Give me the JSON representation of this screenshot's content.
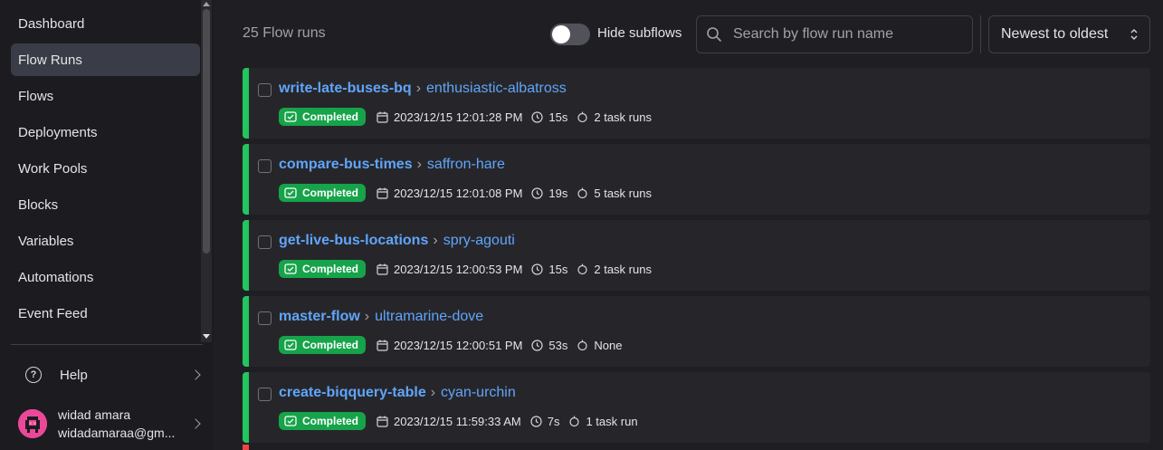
{
  "sidebar": {
    "items": [
      {
        "label": "Dashboard"
      },
      {
        "label": "Flow Runs",
        "active": true
      },
      {
        "label": "Flows"
      },
      {
        "label": "Deployments"
      },
      {
        "label": "Work Pools"
      },
      {
        "label": "Blocks"
      },
      {
        "label": "Variables"
      },
      {
        "label": "Automations"
      },
      {
        "label": "Event Feed"
      }
    ],
    "help_label": "Help",
    "user": {
      "name": "widad amara",
      "email": "widadamaraa@gm..."
    }
  },
  "header": {
    "count_label": "25 Flow runs",
    "hide_subflows_label": "Hide subflows",
    "hide_subflows_on": false,
    "search_placeholder": "Search by flow run name",
    "sort_value": "Newest to oldest"
  },
  "runs": [
    {
      "flow": "write-late-buses-bq",
      "name": "enthusiastic-albatross",
      "status": "Completed",
      "timestamp": "2023/12/15 12:01:28 PM",
      "duration": "15s",
      "tasks": "2 task runs"
    },
    {
      "flow": "compare-bus-times",
      "name": "saffron-hare",
      "status": "Completed",
      "timestamp": "2023/12/15 12:01:08 PM",
      "duration": "19s",
      "tasks": "5 task runs"
    },
    {
      "flow": "get-live-bus-locations",
      "name": "spry-agouti",
      "status": "Completed",
      "timestamp": "2023/12/15 12:00:53 PM",
      "duration": "15s",
      "tasks": "2 task runs"
    },
    {
      "flow": "master-flow",
      "name": "ultramarine-dove",
      "status": "Completed",
      "timestamp": "2023/12/15 12:00:51 PM",
      "duration": "53s",
      "tasks": "None"
    },
    {
      "flow": "create-biqquery-table",
      "name": "cyan-urchin",
      "status": "Completed",
      "timestamp": "2023/12/15 11:59:33 AM",
      "duration": "7s",
      "tasks": "1 task run"
    }
  ],
  "colors": {
    "completed": "#22c55e",
    "link": "#60a5fa",
    "active_nav": "#3a3d48",
    "avatar": "#ec4899"
  }
}
